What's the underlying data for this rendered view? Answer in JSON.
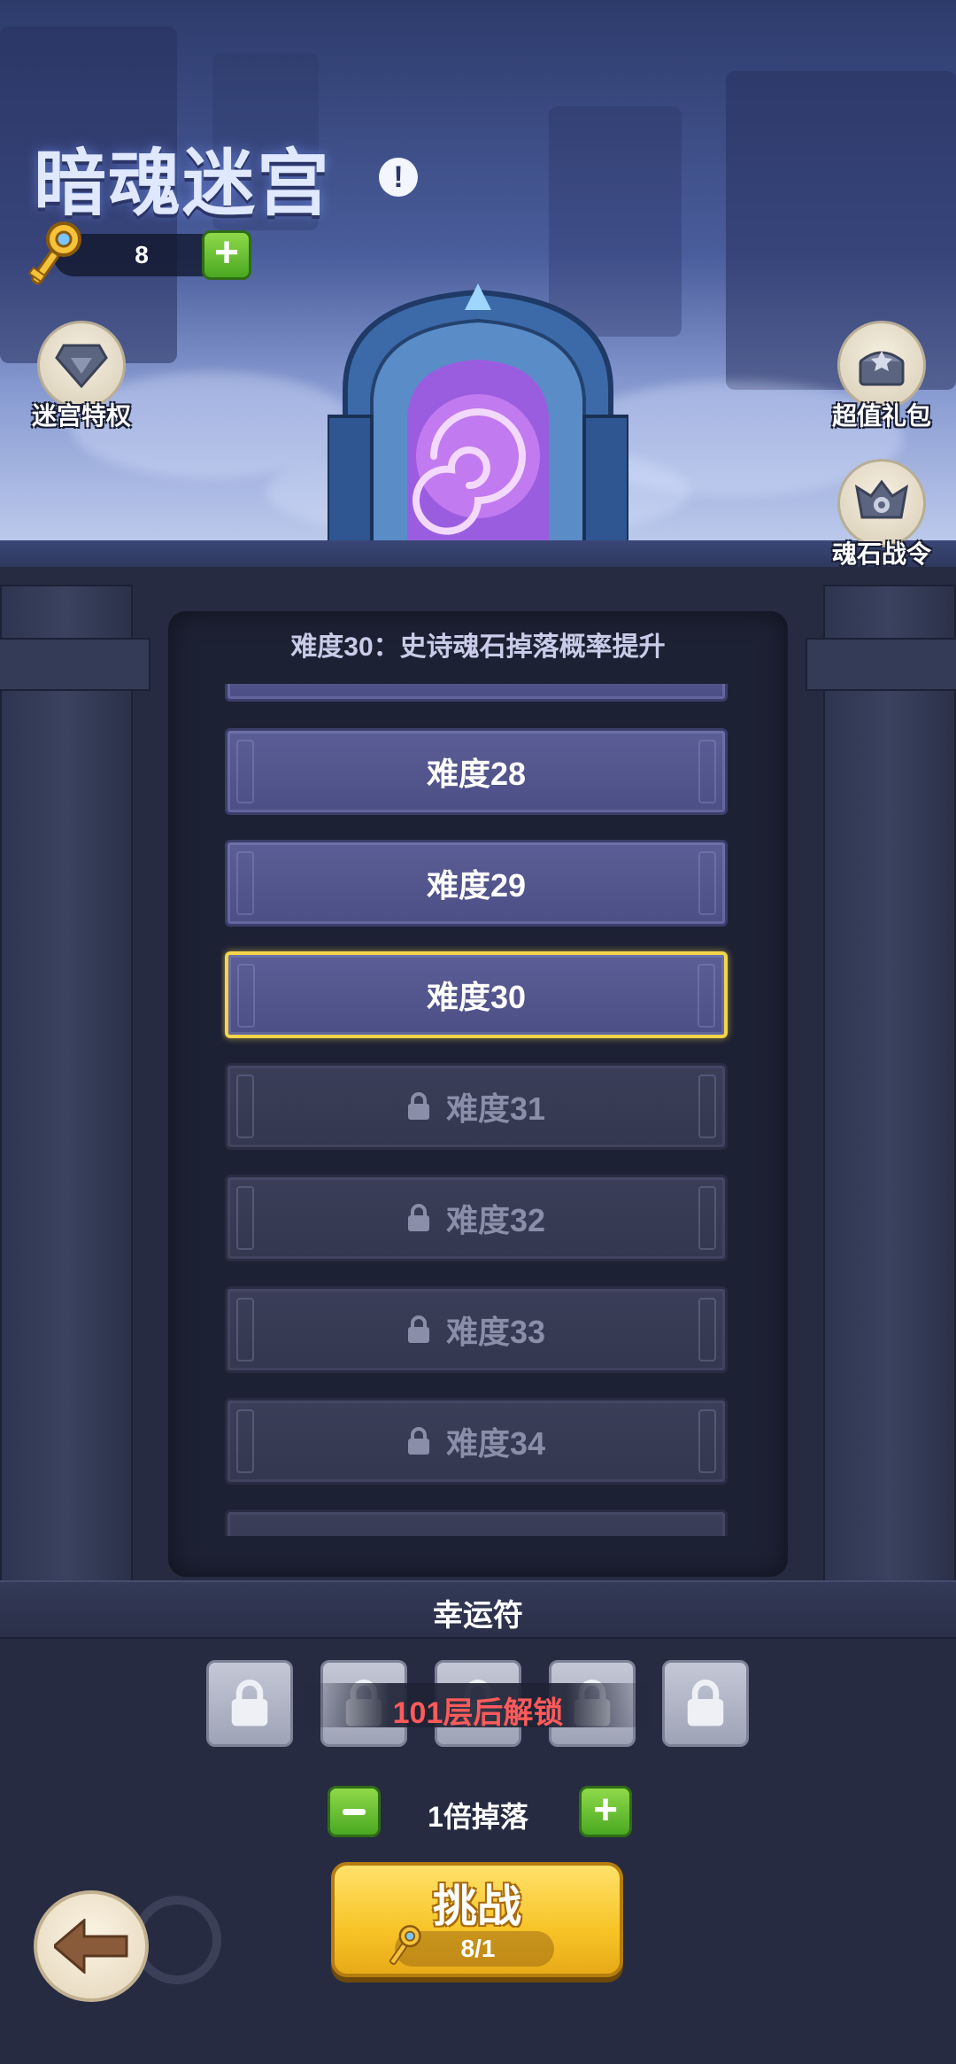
{
  "header": {
    "title": "暗魂迷宫",
    "info_icon": "info-icon",
    "key_count": "8"
  },
  "side_buttons": {
    "privilege_label": "迷宫特权",
    "gift_label": "超值礼包",
    "pass_label": "魂石战令"
  },
  "levels": {
    "notice": "难度30：史诗魂石掉落概率提升",
    "items": [
      {
        "label": "难度28",
        "state": "unlocked"
      },
      {
        "label": "难度29",
        "state": "unlocked"
      },
      {
        "label": "难度30",
        "state": "selected"
      },
      {
        "label": "难度31",
        "state": "locked"
      },
      {
        "label": "难度32",
        "state": "locked"
      },
      {
        "label": "难度33",
        "state": "locked"
      },
      {
        "label": "难度34",
        "state": "locked"
      }
    ]
  },
  "lucky": {
    "title": "幸运符",
    "unlock_hint": "101层后解锁",
    "slot_count": 5
  },
  "footer": {
    "multiplier_label": "1倍掉落",
    "challenge_label": "挑战",
    "cost": "8/1"
  },
  "colors": {
    "selected_border": "#f5d44a",
    "unlock_hint": "#ff5a5a",
    "challenge_button": "#f7c427",
    "plus_button": "#4aa822"
  }
}
